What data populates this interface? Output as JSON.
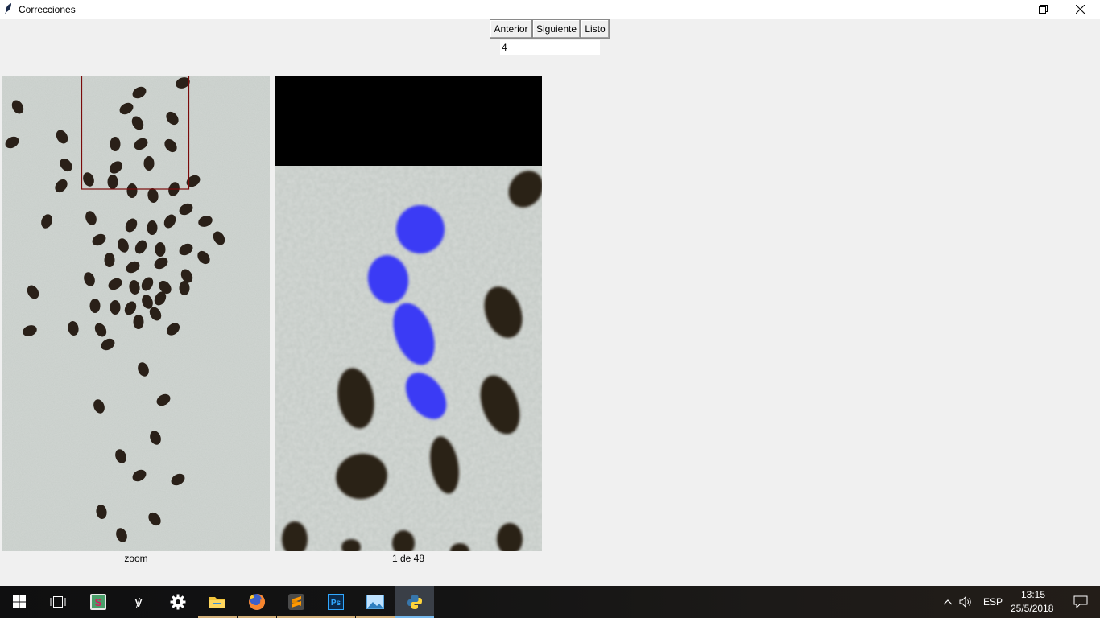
{
  "window": {
    "title": "Correcciones"
  },
  "toolbar": {
    "prev_label": "Anterior",
    "next_label": "Siguiente",
    "done_label": "Listo",
    "index_value": "4"
  },
  "panels": {
    "left_caption": "zoom",
    "right_caption": "1 de 48"
  },
  "taskbar": {
    "apps": [
      "start-icon",
      "task-view-icon",
      "slack-icon",
      "sourcetree-icon",
      "settings-icon",
      "file-explorer-icon",
      "firefox-icon",
      "sublime-text-icon",
      "photoshop-icon",
      "photos-icon",
      "python-icon"
    ],
    "language": "ESP",
    "time": "13:15",
    "date": "25/5/2018"
  },
  "colors": {
    "highlight_seeds": "#3a3af5",
    "seed": "#2a2018",
    "background_sample": "#c9cfca",
    "zoom_frame": "#7a0a0a"
  }
}
